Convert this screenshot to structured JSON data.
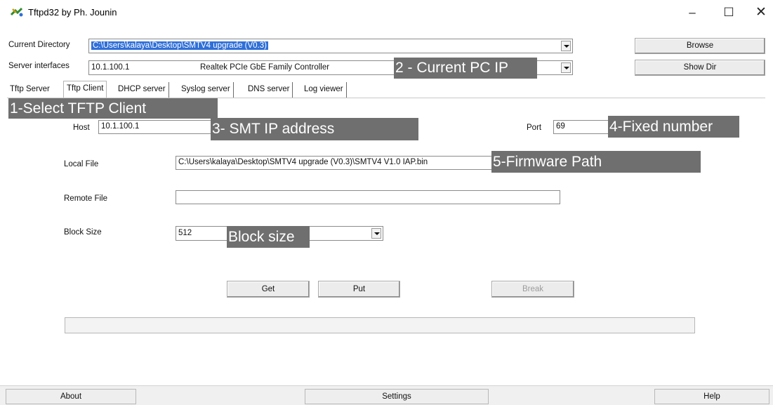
{
  "window": {
    "title": "Tftpd32 by Ph. Jounin",
    "minimize": "–",
    "maximize": "☐",
    "close": "✕"
  },
  "header": {
    "current_directory_label": "Current Directory",
    "current_directory_value": "C:\\Users\\kalaya\\Desktop\\SMTV4 upgrade (V0.3)",
    "browse_label": "Browse",
    "server_interfaces_label": "Server interfaces",
    "server_interface_ip": "10.1.100.1",
    "server_interface_name": "Realtek PCIe GbE Family Controller",
    "show_dir_label": "Show Dir"
  },
  "tabs": [
    {
      "label": "Tftp Server"
    },
    {
      "label": "Tftp Client"
    },
    {
      "label": "DHCP server"
    },
    {
      "label": "Syslog server"
    },
    {
      "label": "DNS server"
    },
    {
      "label": "Log viewer"
    }
  ],
  "client": {
    "host_label": "Host",
    "host_value": "10.1.100.1",
    "port_label": "Port",
    "port_value": "69",
    "local_file_label": "Local File",
    "local_file_value": "C:\\Users\\kalaya\\Desktop\\SMTV4 upgrade (V0.3)\\SMTV4 V1.0 IAP.bin",
    "remote_file_label": "Remote File",
    "remote_file_value": "",
    "block_size_label": "Block Size",
    "block_size_value": "512",
    "get_label": "Get",
    "put_label": "Put",
    "break_label": "Break"
  },
  "callouts": {
    "tftp_client": "1-Select TFTP Client",
    "pc_ip": "2 - Current PC IP",
    "smt_ip": "3- SMT IP address",
    "fixed_number": "4-Fixed number",
    "firmware_path": "5-Firmware Path",
    "block_size": "Block size"
  },
  "statusbar": {
    "about_label": "About",
    "settings_label": "Settings",
    "help_label": "Help"
  },
  "colors": {
    "callout_bg": "#6f6f6f",
    "selection_bg": "#2f6fd8"
  },
  "icons": {
    "app": "tftpd-app-icon",
    "dropdown": "chevron-down-icon"
  }
}
